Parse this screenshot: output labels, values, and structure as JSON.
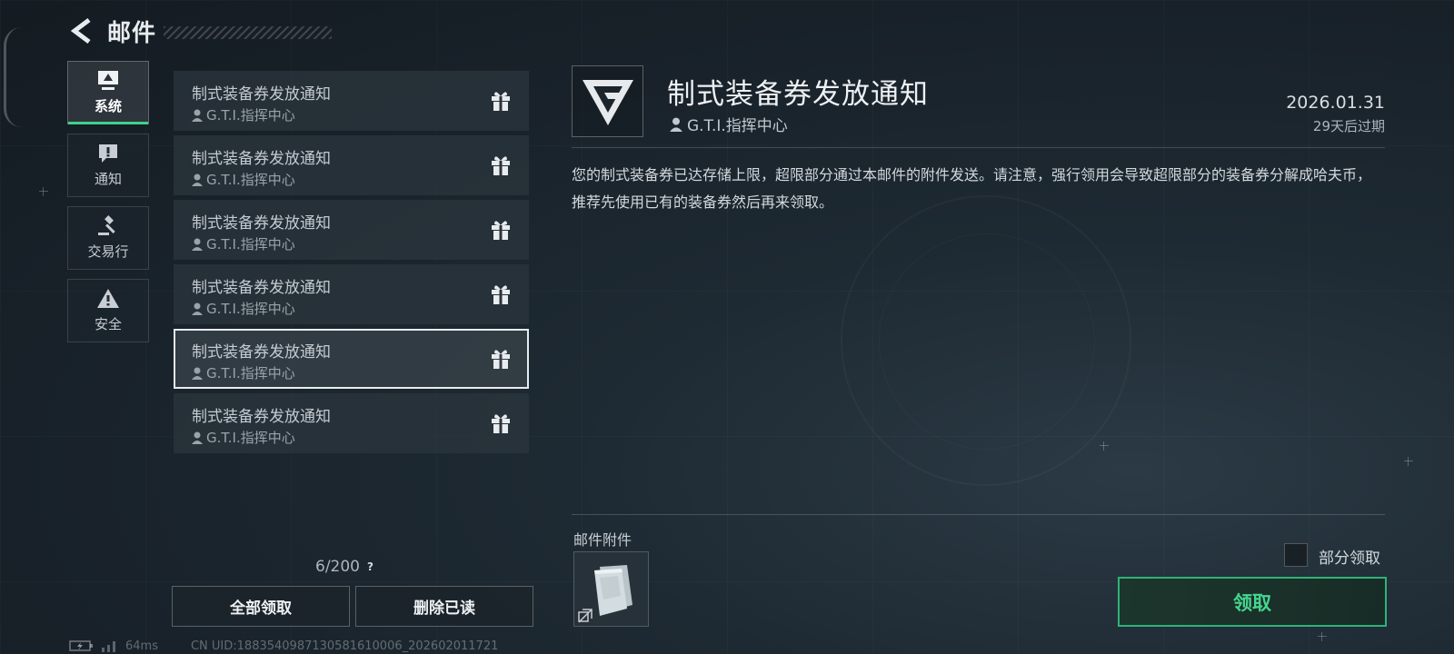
{
  "header": {
    "title": "邮件"
  },
  "categories": [
    {
      "label": "系统",
      "icon": "monitor-icon",
      "active": true
    },
    {
      "label": "通知",
      "icon": "notice-icon",
      "active": false
    },
    {
      "label": "交易行",
      "icon": "gavel-icon",
      "active": false
    },
    {
      "label": "安全",
      "icon": "warning-icon",
      "active": false
    }
  ],
  "mails": [
    {
      "title": "制式装备券发放通知",
      "sender": "G.T.I.指挥中心",
      "icon": "gift-icon"
    },
    {
      "title": "制式装备券发放通知",
      "sender": "G.T.I.指挥中心",
      "icon": "gift-icon"
    },
    {
      "title": "制式装备券发放通知",
      "sender": "G.T.I.指挥中心",
      "icon": "gift-icon"
    },
    {
      "title": "制式装备券发放通知",
      "sender": "G.T.I.指挥中心",
      "icon": "gift-icon"
    },
    {
      "title": "制式装备券发放通知",
      "sender": "G.T.I.指挥中心",
      "icon": "gift-icon",
      "selected": true
    },
    {
      "title": "制式装备券发放通知",
      "sender": "G.T.I.指挥中心",
      "icon": "gift-icon"
    }
  ],
  "mail_count": "6/200",
  "mail_count_help": "?",
  "buttons": {
    "claim_all": "全部领取",
    "delete_read": "删除已读",
    "claim": "领取"
  },
  "status": {
    "ping": "64ms",
    "uid": "CN UID:1883540987130581610006_202602011721"
  },
  "detail": {
    "title": "制式装备券发放通知",
    "sender": "G.T.I.指挥中心",
    "date": "2026.01.31",
    "expire": "29天后过期",
    "body": "您的制式装备券已达存储上限，超限部分通过本邮件的附件发送。请注意，强行领用会导致超限部分的装备券分解成哈夫币，推荐先使用已有的装备券然后再来领取。",
    "logo_icon": "gti-logo-icon"
  },
  "attachments": {
    "label": "邮件附件",
    "items": [
      {
        "icon": "voucher-item-icon",
        "badge_icon": "no-trade-icon"
      }
    ]
  },
  "partial_claim": {
    "label": "部分领取",
    "checked": false
  },
  "colors": {
    "accent_green": "#3ed28b",
    "claim_text": "#46d690",
    "claim_border": "#2fb277"
  }
}
